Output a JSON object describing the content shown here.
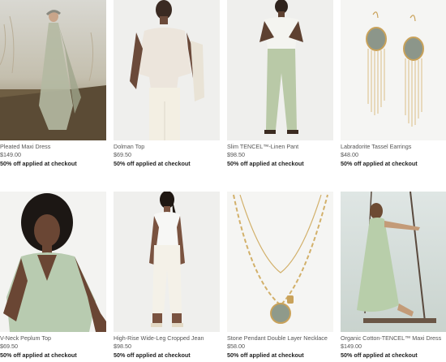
{
  "products": [
    {
      "name": "Pleated Maxi Dress",
      "price": "$149.00",
      "promo": "50% off applied at checkout"
    },
    {
      "name": "Dolman Top",
      "price": "$69.50",
      "promo": "50% off applied at checkout"
    },
    {
      "name": "Slim TENCEL™-Linen Pant",
      "price": "$98.50",
      "promo": "50% off applied at checkout"
    },
    {
      "name": "Labradorite Tassel Earrings",
      "price": "$48.00",
      "promo": "50% off applied at checkout"
    },
    {
      "name": "V-Neck Peplum Top",
      "price": "$69.50",
      "promo": "50% off applied at checkout"
    },
    {
      "name": "High-Rise Wide-Leg Cropped Jean",
      "price": "$98.50",
      "promo": "50% off applied at checkout"
    },
    {
      "name": "Stone Pendant Double Layer Necklace",
      "price": "$58.00",
      "promo": "50% off applied at checkout"
    },
    {
      "name": "Organic Cotton-TENCEL™ Maxi Dress",
      "price": "$149.00",
      "promo": "50% off applied at checkout"
    }
  ]
}
